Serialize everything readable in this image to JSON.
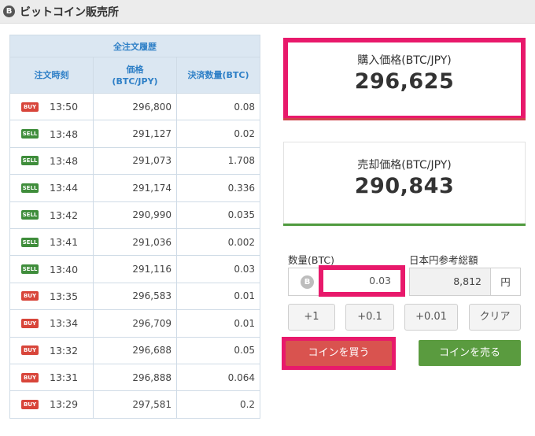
{
  "header": {
    "logo_glyph": "B",
    "title": "ビットコイン販売所"
  },
  "history": {
    "caption": "全注文履歴",
    "columns": {
      "time": "注文時刻",
      "price_line1": "価格",
      "price_line2": "(BTC/JPY)",
      "amount": "決済数量(BTC)"
    },
    "rows": [
      {
        "side": "BUY",
        "time": "13:50",
        "price": "296,800",
        "amount": "0.08"
      },
      {
        "side": "SELL",
        "time": "13:48",
        "price": "291,127",
        "amount": "0.02"
      },
      {
        "side": "SELL",
        "time": "13:48",
        "price": "291,073",
        "amount": "1.708"
      },
      {
        "side": "SELL",
        "time": "13:44",
        "price": "291,174",
        "amount": "0.336"
      },
      {
        "side": "SELL",
        "time": "13:42",
        "price": "290,990",
        "amount": "0.035"
      },
      {
        "side": "SELL",
        "time": "13:41",
        "price": "291,036",
        "amount": "0.002"
      },
      {
        "side": "SELL",
        "time": "13:40",
        "price": "291,116",
        "amount": "0.03"
      },
      {
        "side": "BUY",
        "time": "13:35",
        "price": "296,583",
        "amount": "0.01"
      },
      {
        "side": "BUY",
        "time": "13:34",
        "price": "296,709",
        "amount": "0.01"
      },
      {
        "side": "BUY",
        "time": "13:32",
        "price": "296,688",
        "amount": "0.05"
      },
      {
        "side": "BUY",
        "time": "13:31",
        "price": "296,888",
        "amount": "0.064"
      },
      {
        "side": "BUY",
        "time": "13:29",
        "price": "297,581",
        "amount": "0.2"
      }
    ]
  },
  "buy_price": {
    "label": "購入価格(BTC/JPY)",
    "value": "296,625"
  },
  "sell_price": {
    "label": "売却価格(BTC/JPY)",
    "value": "290,843"
  },
  "quantity": {
    "label": "数量(BTC)",
    "value": "0.03",
    "coin_glyph": "B"
  },
  "jpy_reference": {
    "label": "日本円参考総額",
    "value": "8,812",
    "unit": "円"
  },
  "steps": {
    "plus1": "+1",
    "plus01": "+0.1",
    "plus001": "+0.01",
    "clear": "クリア"
  },
  "actions": {
    "buy": "コインを買う",
    "sell": "コインを売る"
  },
  "colors": {
    "highlight": "#e8196b",
    "buy": "#d9534f",
    "sell": "#5a9b3f",
    "table_head": "#2f80c7"
  }
}
